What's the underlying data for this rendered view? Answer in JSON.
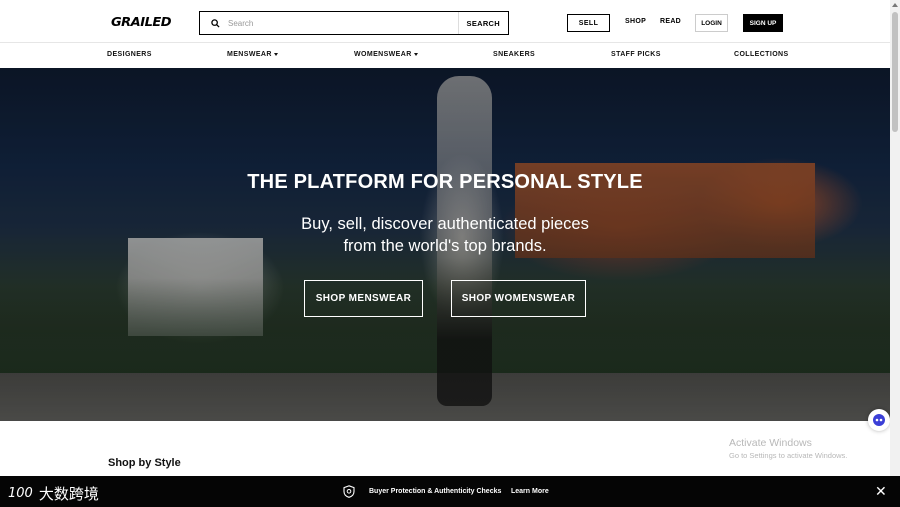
{
  "header": {
    "logo": "GRAILED",
    "search": {
      "placeholder": "Search",
      "button_label": "SEARCH"
    },
    "sell_label": "SELL",
    "shop_label": "SHOP",
    "read_label": "READ",
    "login_label": "LOGIN",
    "signup_label": "SIGN UP"
  },
  "category_nav": [
    {
      "label": "DESIGNERS",
      "has_dropdown": false
    },
    {
      "label": "MENSWEAR",
      "has_dropdown": true
    },
    {
      "label": "WOMENSWEAR",
      "has_dropdown": true
    },
    {
      "label": "SNEAKERS",
      "has_dropdown": false
    },
    {
      "label": "STAFF PICKS",
      "has_dropdown": false
    },
    {
      "label": "COLLECTIONS",
      "has_dropdown": false
    }
  ],
  "hero": {
    "title": "THE PLATFORM FOR PERSONAL STYLE",
    "subtitle_line1": "Buy, sell, discover authenticated pieces",
    "subtitle_line2": "from the world's top brands.",
    "cta_men": "SHOP MENSWEAR",
    "cta_women": "SHOP WOMENSWEAR"
  },
  "section": {
    "shop_by_style": "Shop by Style"
  },
  "os_watermark": {
    "line1": "Activate Windows",
    "line2": "Go to Settings to activate Windows."
  },
  "footer_banner": {
    "brand_number": "100",
    "brand_text": "大数跨境",
    "text": "Buyer Protection & Authenticity Checks",
    "link": "Learn More"
  },
  "icons": {
    "search": "search-icon",
    "chat": "chat-icon",
    "shield": "shield-icon",
    "close": "close-icon"
  },
  "colors": {
    "primary": "#000000",
    "background": "#ffffff",
    "footer": "#050505"
  }
}
